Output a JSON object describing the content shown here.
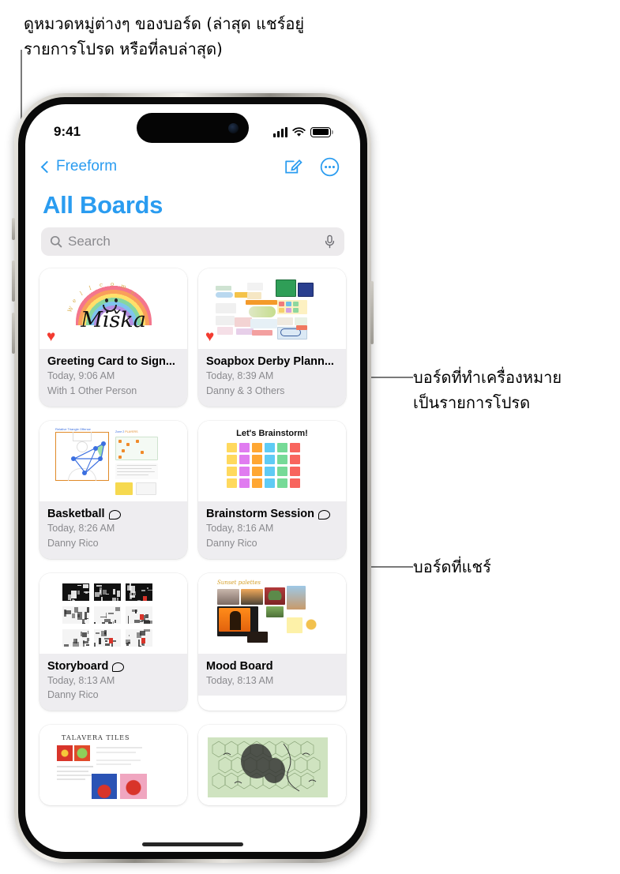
{
  "annotations": {
    "top": "ดูหมวดหมู่ต่างๆ ของบอร์ด (ล่าสุด แชร์อยู่\nรายการโปรด หรือที่ลบล่าสุด)",
    "favorite": "บอร์ดที่ทำเครื่องหมาย\nเป็นรายการโปรด",
    "shared": "บอร์ดที่แชร์"
  },
  "status_bar": {
    "time": "9:41",
    "cellular_icon": "signal-bars-icon",
    "wifi_icon": "wifi-icon",
    "battery_icon": "battery-icon"
  },
  "nav_bar": {
    "back_label": "Freeform",
    "back_icon": "chevron-left-icon",
    "compose_icon": "compose-icon",
    "more_icon": "more-circle-icon"
  },
  "page_title": "All Boards",
  "search": {
    "placeholder": "Search",
    "value": "",
    "search_icon": "search-icon",
    "mic_icon": "microphone-icon"
  },
  "boards": [
    {
      "title": "Greeting Card to Sign...",
      "time": "Today, 9:06 AM",
      "participants": "With 1 Other Person",
      "favorite": true,
      "shared": false,
      "thumb": "greeting-card",
      "artwork_text": {
        "script": "Miška",
        "arc": "Welcome"
      }
    },
    {
      "title": "Soapbox Derby Plann...",
      "time": "Today, 8:39 AM",
      "participants": "Danny & 3 Others",
      "favorite": true,
      "shared": false,
      "thumb": "soapbox-derby"
    },
    {
      "title": "Basketball",
      "time": "Today, 8:26 AM",
      "participants": "Danny Rico",
      "favorite": false,
      "shared": true,
      "thumb": "basketball"
    },
    {
      "title": "Brainstorm Session",
      "time": "Today, 8:16 AM",
      "participants": "Danny Rico",
      "favorite": false,
      "shared": true,
      "thumb": "brainstorm",
      "artwork_text": {
        "heading": "Let's Brainstorm!"
      }
    },
    {
      "title": "Storyboard",
      "time": "Today, 8:13 AM",
      "participants": "Danny Rico",
      "favorite": false,
      "shared": true,
      "thumb": "storyboard"
    },
    {
      "title": "Mood Board",
      "time": "Today, 8:13 AM",
      "participants": "",
      "favorite": false,
      "shared": false,
      "thumb": "mood-board",
      "artwork_text": {
        "heading": "Sunset palettes"
      }
    },
    {
      "title": "",
      "time": "",
      "participants": "",
      "favorite": false,
      "shared": false,
      "thumb": "talavera-tiles",
      "artwork_text": {
        "heading": "TALAVERA TILES"
      }
    },
    {
      "title": "",
      "time": "",
      "participants": "",
      "favorite": false,
      "shared": false,
      "thumb": "hex-map"
    }
  ],
  "colors": {
    "accent_blue": "#2a9cf0",
    "heart_red": "#f33b30",
    "card_meta_bg": "#eeedf0",
    "search_bg": "#eceaec",
    "subtitle_gray": "#8a8a8e"
  },
  "sticky_palette": [
    "#ffd95e",
    "#e07cf0",
    "#ffa733",
    "#5ecbf5",
    "#76da97",
    "#f8655e"
  ]
}
